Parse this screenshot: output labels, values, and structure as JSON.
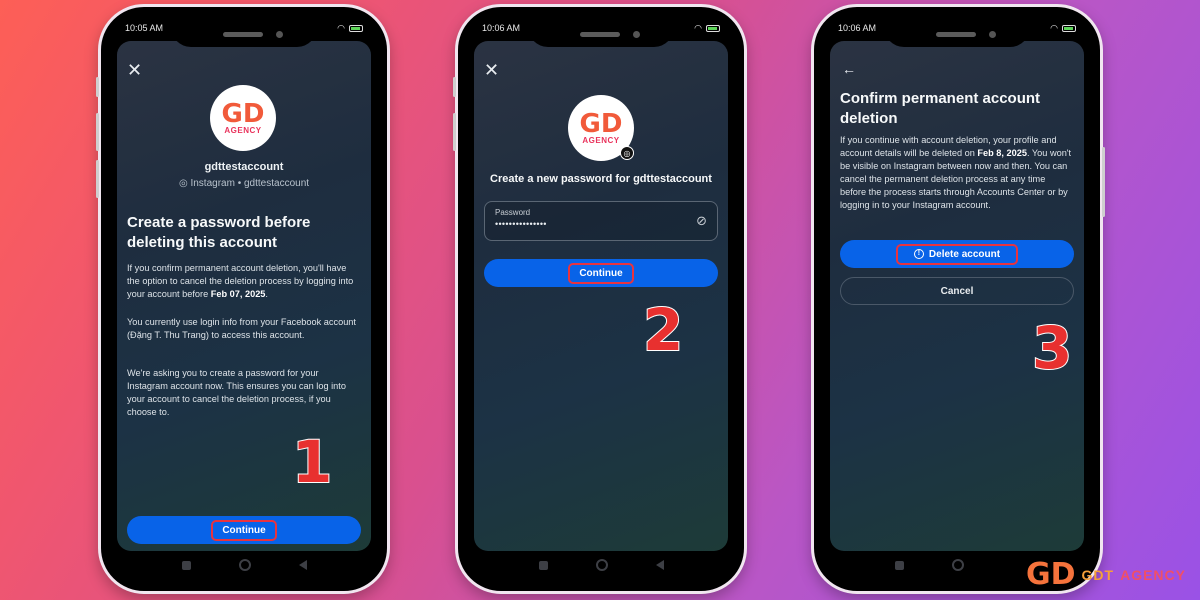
{
  "colors": {
    "primary_button": "#0863e8",
    "highlight": "#e8333f",
    "step_number": "#e8302f"
  },
  "phones": [
    {
      "status": {
        "time": "10:05 AM",
        "battery": "71"
      },
      "nav_icon": "close-icon",
      "close_glyph": "✕",
      "avatar": {
        "mark": "GD",
        "text": "AGENCY"
      },
      "username": "gdttestaccount",
      "account_line": "Instagram • gdttestaccount",
      "heading": "Create a password before deleting this account",
      "paragraphs": [
        {
          "text": "If you confirm permanent account deletion, you'll have the option to cancel the deletion process by logging into your account before ",
          "bold": "Feb 07, 2025",
          "tail": "."
        },
        {
          "text": "You currently use login info from your Facebook account (Đặng T. Thu Trang) to access this account."
        },
        {
          "text": "We're asking you to create a password for your Instagram account now. This ensures you can log into your account to cancel the deletion process, if you choose to."
        }
      ],
      "primary_button": "Continue",
      "step": "1"
    },
    {
      "status": {
        "time": "10:06 AM",
        "battery": "71"
      },
      "nav_icon": "close-icon",
      "close_glyph": "✕",
      "avatar": {
        "mark": "GD",
        "text": "AGENCY"
      },
      "heading": "Create a new password for gdttestaccount",
      "password_field": {
        "label": "Password",
        "value": "•••••••••••••••"
      },
      "primary_button": "Continue",
      "step": "2"
    },
    {
      "status": {
        "time": "10:06 AM",
        "battery": "71"
      },
      "nav_icon": "back-arrow-icon",
      "back_glyph": "←",
      "heading": "Confirm permanent account deletion",
      "paragraph": {
        "text": "If you continue with account deletion, your profile and account details will be deleted on ",
        "bold1": "Feb 8, 2025",
        "text2": ". You won't be visible on Instagram between now and then. You can cancel the permanent deletion process at any time before the process starts through Accounts Center or by logging in to your Instagram account."
      },
      "primary_button": "Delete account",
      "secondary_button": "Cancel",
      "step": "3"
    }
  ],
  "brand": {
    "mark": "GD",
    "gdt": "GDT",
    "agency": "AGENCY"
  }
}
